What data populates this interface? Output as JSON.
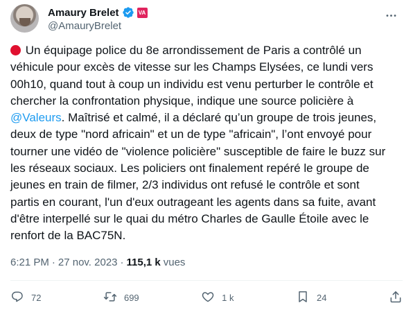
{
  "author": {
    "display_name": "Amaury Brelet",
    "handle": "@AmauryBrelet",
    "badge_text": "VA"
  },
  "tweet": {
    "text_before_mention": " Un équipage police du 8e arrondissement de Paris a contrôlé un\nvéhicule pour excès de vitesse sur les Champs Elysées, ce lundi vers\n00h10, quand tout à coup un individu est venu perturber le contrôle et\nchercher la confrontation physique, indique une source policière à\n",
    "mention": "@Valeurs",
    "text_after_mention": ". Maîtrisé et calmé, il a déclaré qu’un groupe de trois jeunes,\ndeux de type \"nord africain\" et un de type \"africain\", l’ont envoyé pour\ntourner une vidéo de \"violence policière\" susceptible de faire le buzz sur\nles réseaux sociaux. Les policiers ont finalement repéré le groupe de\njeunes en train de filmer, 2/3 individus ont refusé le contrôle et sont\npartis en courant, l'un d'eux outrageant les agents dans sa fuite, avant\nd'être interpellé sur le quai du métro Charles de Gaulle Étoile avec le\nrenfort de la BAC75N."
  },
  "meta": {
    "time": "6:21 PM",
    "separator": "·",
    "date": "27 nov. 2023",
    "views_count": "115,1 k",
    "views_label": "vues"
  },
  "actions": {
    "replies": "72",
    "reposts": "699",
    "likes": "1 k",
    "bookmarks": "24"
  },
  "icons": {
    "more": "more-icon",
    "verified": "verified-badge-icon",
    "reply": "reply-icon",
    "repost": "repost-icon",
    "like": "like-icon",
    "bookmark": "bookmark-icon",
    "share": "share-icon"
  },
  "colors": {
    "accent": "#1d9bf0",
    "text": "#0f1419",
    "secondary": "#536471",
    "alert_dot": "#e0102f"
  }
}
